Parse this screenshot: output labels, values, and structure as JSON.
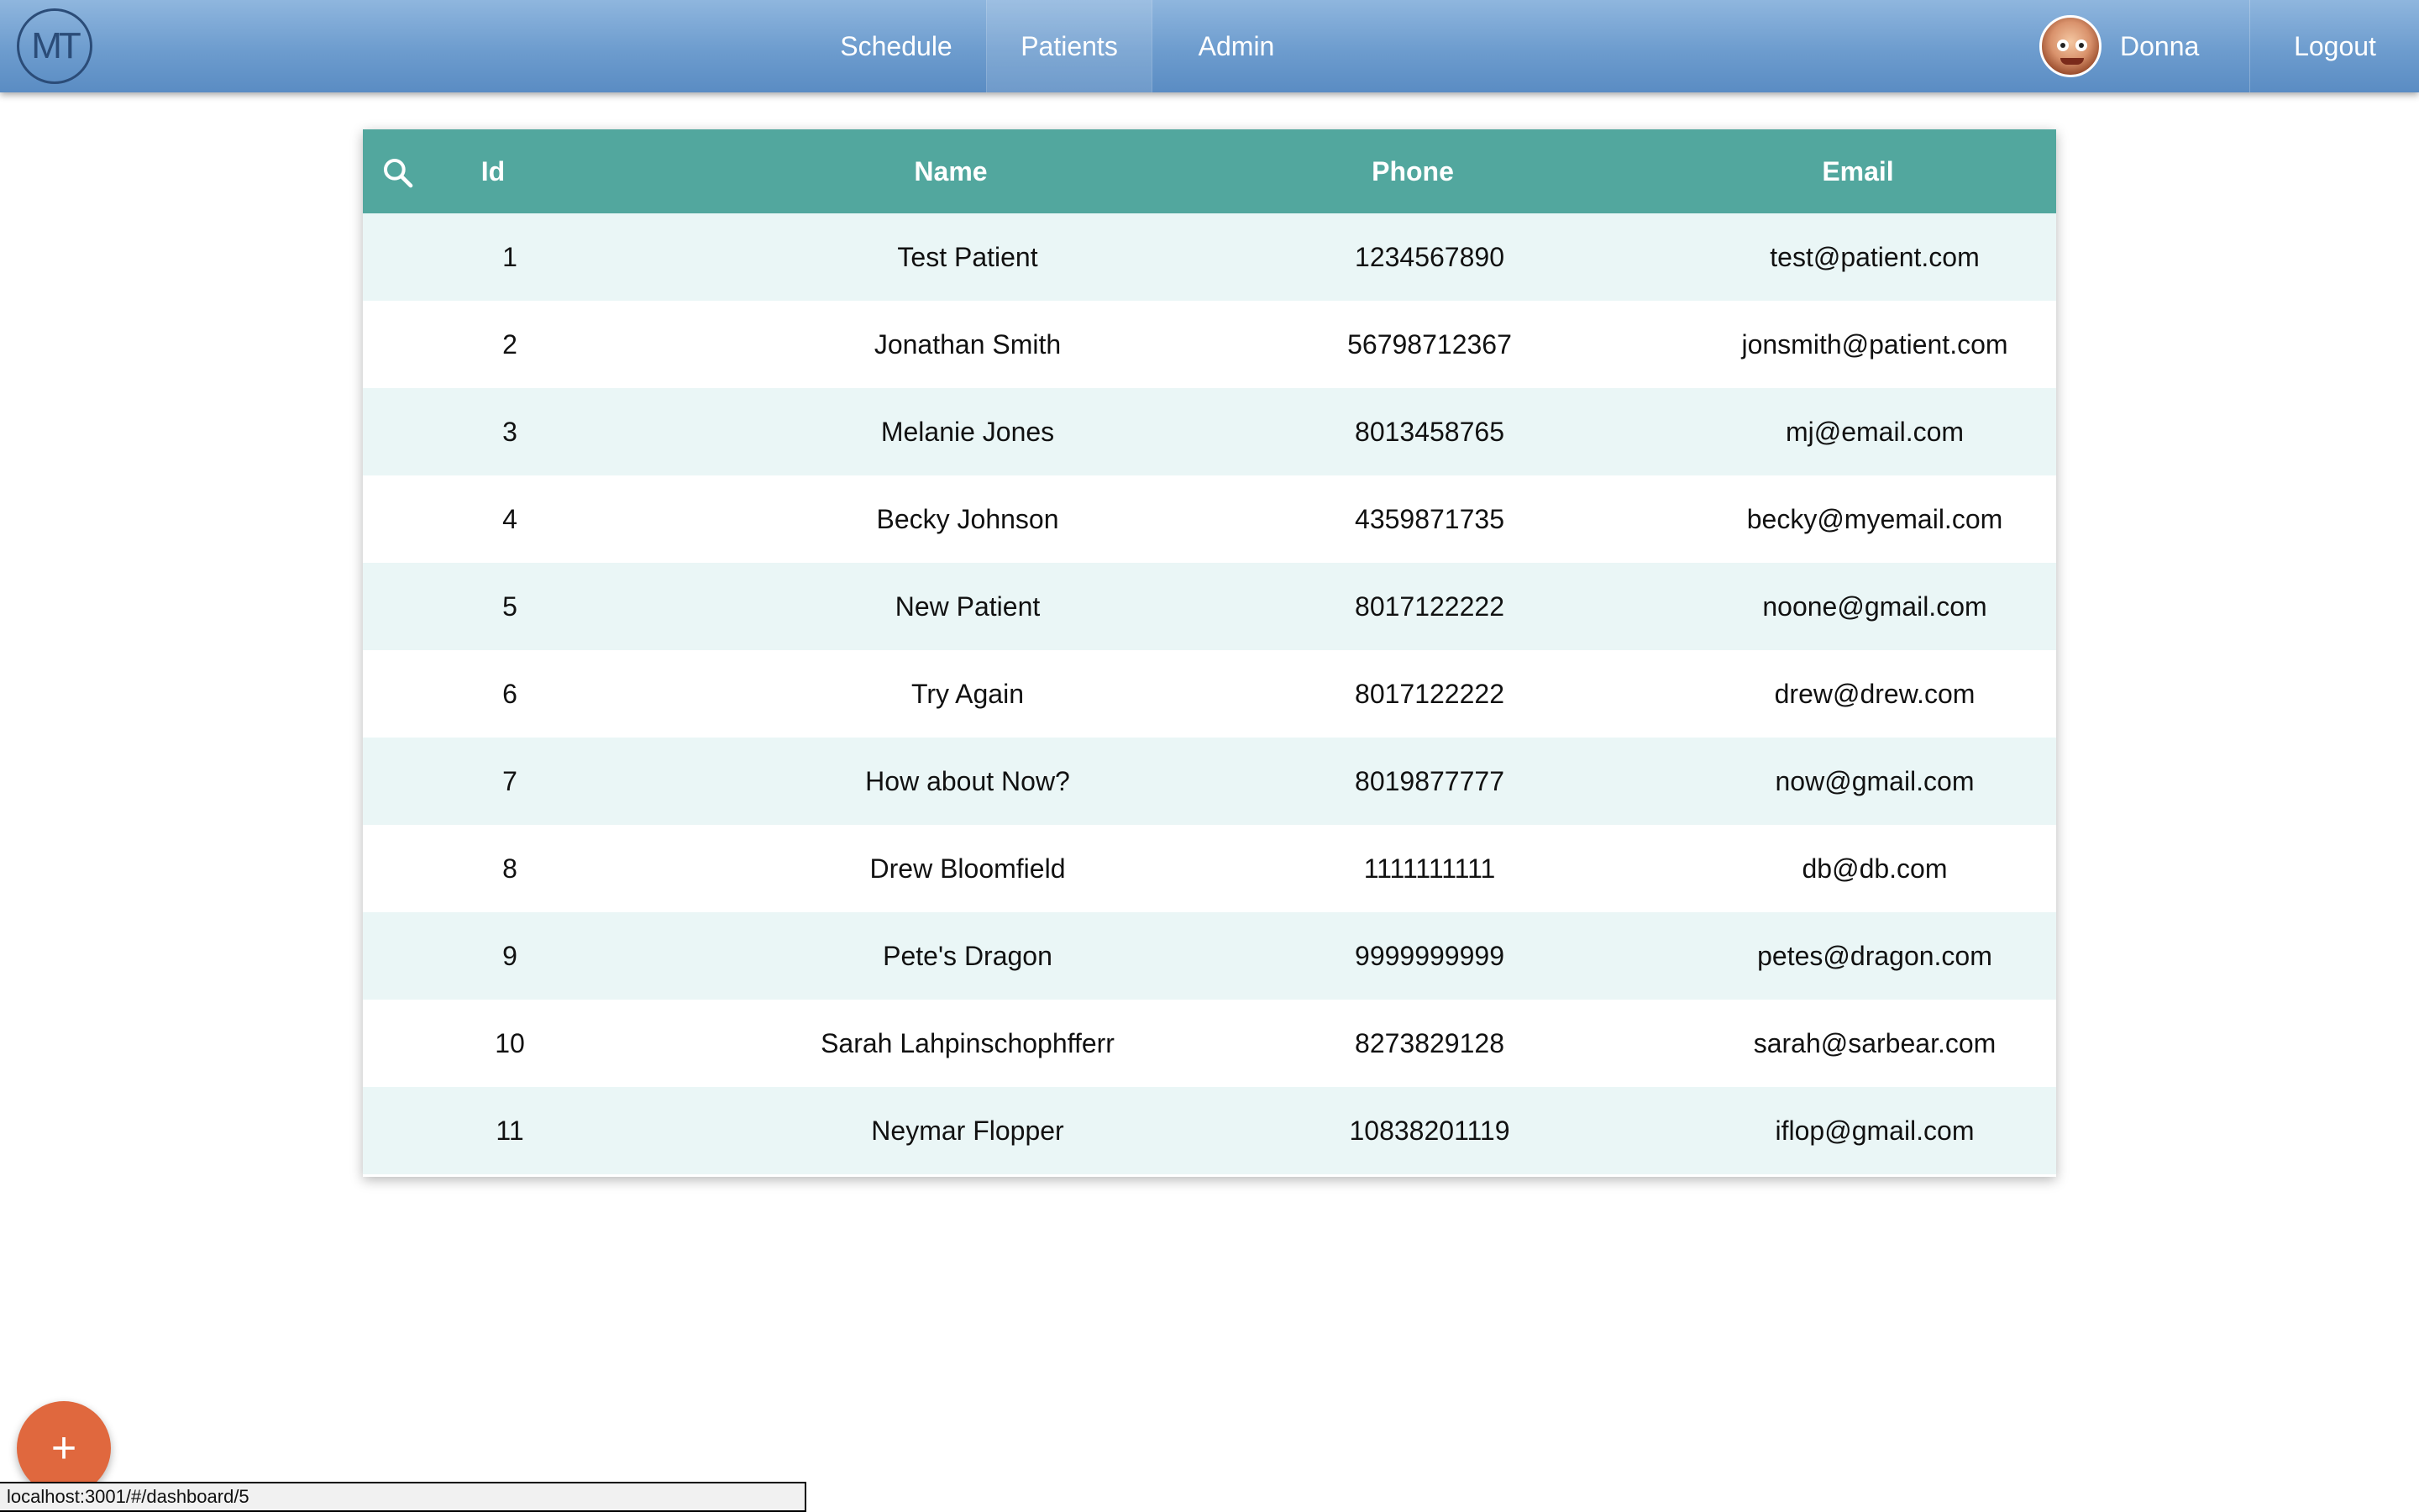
{
  "navbar": {
    "logo_text": "MT",
    "items": [
      {
        "label": "Schedule"
      },
      {
        "label": "Patients"
      },
      {
        "label": "Admin"
      }
    ],
    "user_name": "Donna",
    "logout_label": "Logout"
  },
  "table": {
    "headers": {
      "id": "Id",
      "name": "Name",
      "phone": "Phone",
      "email": "Email"
    },
    "rows": [
      {
        "id": "1",
        "name": "Test Patient",
        "phone": "1234567890",
        "email": "test@patient.com"
      },
      {
        "id": "2",
        "name": "Jonathan Smith",
        "phone": "56798712367",
        "email": "jonsmith@patient.com"
      },
      {
        "id": "3",
        "name": "Melanie Jones",
        "phone": "8013458765",
        "email": "mj@email.com"
      },
      {
        "id": "4",
        "name": "Becky Johnson",
        "phone": "4359871735",
        "email": "becky@myemail.com"
      },
      {
        "id": "5",
        "name": "New Patient",
        "phone": "8017122222",
        "email": "noone@gmail.com"
      },
      {
        "id": "6",
        "name": "Try Again",
        "phone": "8017122222",
        "email": "drew@drew.com"
      },
      {
        "id": "7",
        "name": "How about Now?",
        "phone": "8019877777",
        "email": "now@gmail.com"
      },
      {
        "id": "8",
        "name": "Drew Bloomfield",
        "phone": "1111111111",
        "email": "db@db.com"
      },
      {
        "id": "9",
        "name": "Pete's Dragon",
        "phone": "9999999999",
        "email": "petes@dragon.com"
      },
      {
        "id": "10",
        "name": "Sarah Lahpinschophfferr",
        "phone": "8273829128",
        "email": "sarah@sarbear.com"
      },
      {
        "id": "11",
        "name": "Neymar Flopper",
        "phone": "10838201119",
        "email": "iflop@gmail.com"
      }
    ]
  },
  "fab": {
    "label": "+"
  },
  "statusbar": {
    "url": "localhost:3001/#/dashboard/5"
  },
  "colors": {
    "navbar": "#6d9cce",
    "table_header": "#52a79e",
    "row_alt": "#eaf6f6",
    "fab": "#e0683e"
  }
}
